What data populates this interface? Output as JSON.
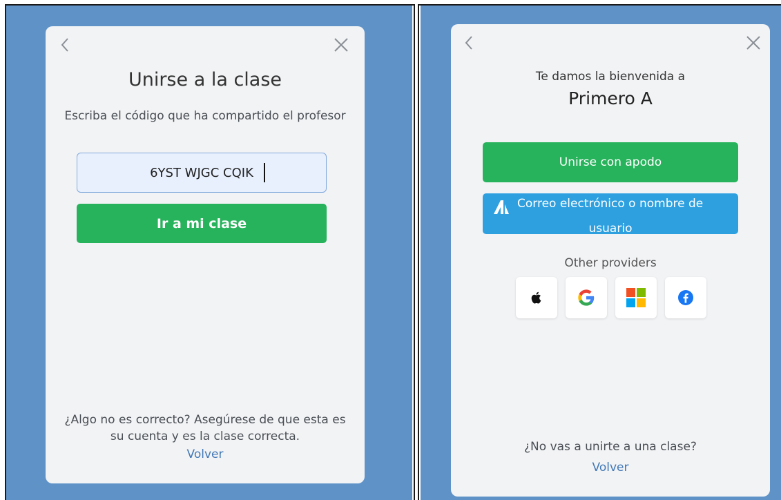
{
  "left": {
    "title": "Unirse a la clase",
    "subtitle": "Escriba el código que ha compartido el profesor",
    "code_input": {
      "value": "6YST WJGC CQIK",
      "placeholder": ""
    },
    "submit_label": "Ir a mi clase",
    "footer_line1": "¿Algo no es correcto? Asegúrese de que esta es",
    "footer_line2": "su cuenta y es la clase correcta.",
    "back_link": "Volver"
  },
  "right": {
    "welcome": "Te damos la bienvenida a",
    "class_name": "Primero A",
    "nickname_label": "Unirse con apodo",
    "email_label_line1": "Correo electrónico o nombre de",
    "email_label_line2": "usuario",
    "other_providers": "Other providers",
    "providers": [
      "apple-icon",
      "google-icon",
      "microsoft-icon",
      "facebook-icon"
    ],
    "footer": "¿No vas a unirte a una clase?",
    "back_link": "Volver"
  },
  "colors": {
    "background": "#5f93c8",
    "card": "#f2f3f5",
    "green": "#27b35b",
    "blue": "#2ea0e0",
    "link": "#4178b6"
  }
}
